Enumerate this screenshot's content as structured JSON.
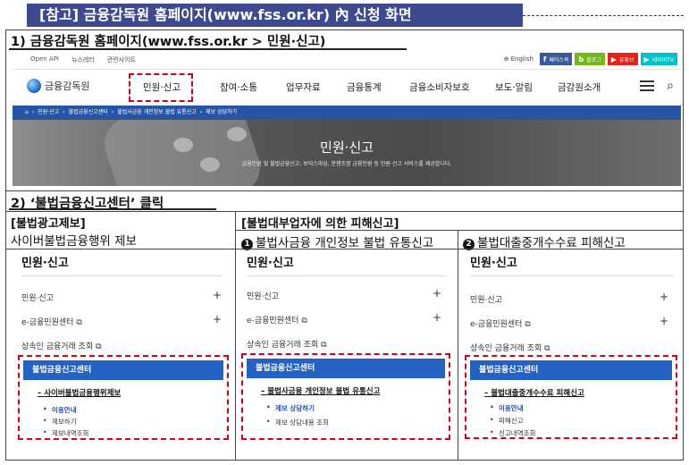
{
  "title": "[참고] 금융감독원 홈페이지(www.fss.or.kr) 內 신청 화면",
  "step1": "1) 금융감독원 홈페이지(www.fss.or.kr > 민원·신고)",
  "step2": "2) ‘불법금융신고센터’ 클릭",
  "site": {
    "util_links": [
      "Open API",
      "뉴스레터",
      "관련사이트"
    ],
    "lang": "English",
    "sns": [
      {
        "label": "페이스북",
        "icon": "f",
        "color": "#3b5998"
      },
      {
        "label": "블로그",
        "icon": "b",
        "color": "#74b816"
      },
      {
        "label": "유튜브",
        "icon": "▶",
        "color": "#e62117"
      },
      {
        "label": "네이버TV",
        "icon": "▶",
        "color": "#00c3c7"
      }
    ],
    "logo": "금융감독원",
    "nav": [
      "민원·신고",
      "참여·소통",
      "업무자료",
      "금융통계",
      "금융소비자보호",
      "보도·알림",
      "금감원소개"
    ],
    "crumb": [
      "민원·신고",
      "불법금융신고센터",
      "불법사금융 개인정보 불법 유통신고",
      "제보 상담하기"
    ],
    "hero_title": "민원·신고",
    "hero_sub": "금융민원 및 불법금융신고, 보이스피싱, 분쟁조정 금융민원 등 민원·신고 서비스를 제공합니다."
  },
  "sections": {
    "left_head": "[불법광고제보]",
    "left_sub": "사이버불법금융행위 제보",
    "right_head": "[불법대부업자에 의한 피해신고]",
    "mid_badge": "❶",
    "mid_sub": "불법사금융 개인정보 불법 유통신고",
    "right_badge": "❷",
    "right_sub": "불법대출중개수수료 피해신고"
  },
  "panel": {
    "title": "민원·신고",
    "rows": [
      "민원·신고",
      "e-금융민원센터 ⧉",
      "상속인 금융거래 조회 ⧉"
    ],
    "center": "불법금융신고센터"
  },
  "panels": [
    {
      "l2": "사이버불법금융행위제보",
      "items": [
        {
          "label": "이용안내",
          "active": true
        },
        {
          "label": "제보하기",
          "active": false
        },
        {
          "label": "제보내역조회",
          "active": false
        }
      ]
    },
    {
      "l2": "불법사금융 개인정보 불법 유통신고",
      "items": [
        {
          "label": "제보 상담하기",
          "active": true
        },
        {
          "label": "제보 상담내용 조회",
          "active": false
        }
      ]
    },
    {
      "l2": "불법대출중개수수료 피해신고",
      "items": [
        {
          "label": "이용안내",
          "active": true
        },
        {
          "label": "피해신고",
          "active": false
        },
        {
          "label": "신고내역조회",
          "active": false
        }
      ]
    }
  ]
}
